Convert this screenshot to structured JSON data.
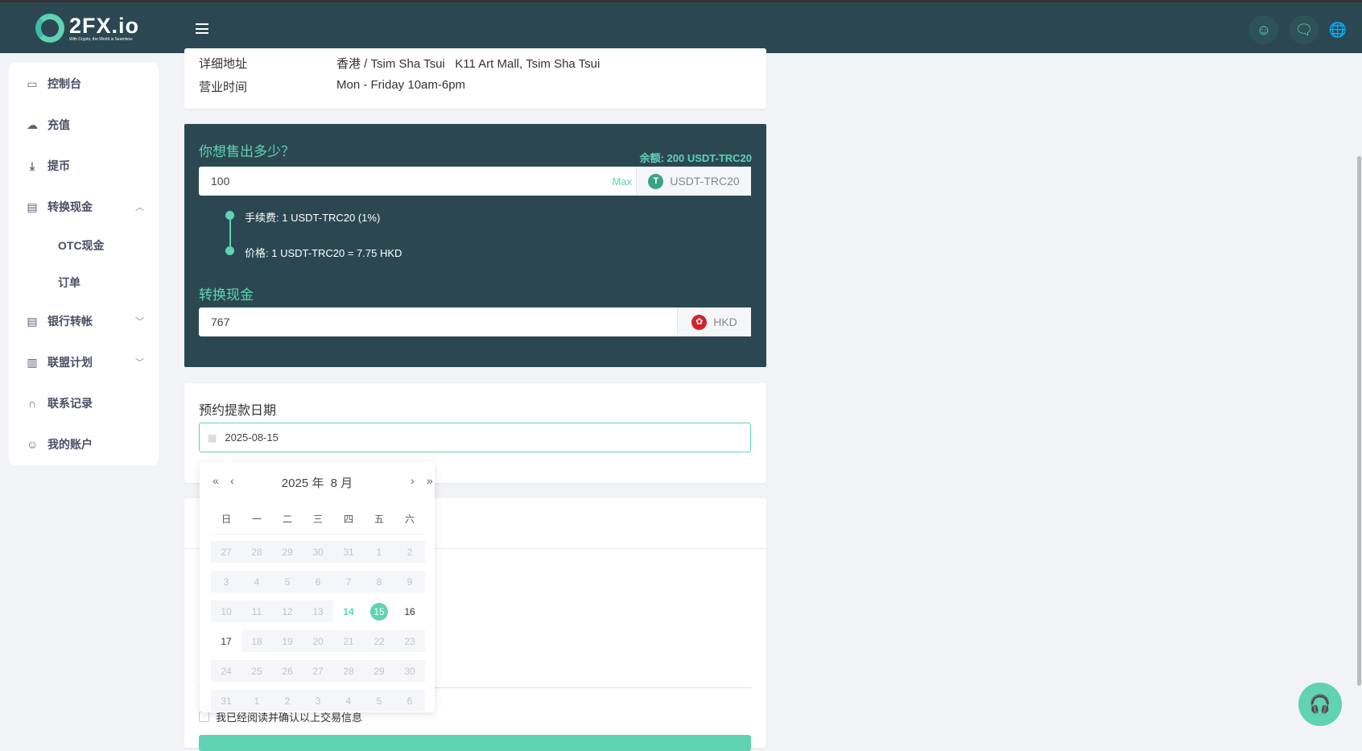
{
  "header": {
    "brand": "2FX.io",
    "tagline": "With Crypto, the World is Seamless"
  },
  "sidebar": {
    "items": [
      {
        "label": "控制台",
        "icon": "monitor-icon"
      },
      {
        "label": "充值",
        "icon": "cloud-upload-icon"
      },
      {
        "label": "提币",
        "icon": "download-icon"
      },
      {
        "label": "转换现金",
        "icon": "document-icon"
      },
      {
        "label": "OTC现金"
      },
      {
        "label": "订单"
      },
      {
        "label": "银行转帐",
        "icon": "document-icon"
      },
      {
        "label": "联盟计划",
        "icon": "building-icon"
      },
      {
        "label": "联系记录",
        "icon": "headset-icon"
      },
      {
        "label": "我的账户",
        "icon": "user-icon"
      }
    ]
  },
  "store": {
    "address_label": "详细地址",
    "address": "香港 / Tsim Sha Tsui   K11 Art Mall, Tsim Sha Tsui",
    "hours_label": "营业时间",
    "hours": "Mon - Friday 10am-6pm"
  },
  "sell": {
    "title": "你想售出多少？",
    "balance": "余额: 200 USDT-TRC20",
    "amount": "100",
    "max": "Max",
    "currency": "USDT-TRC20",
    "fee": "手续费: 1 USDT-TRC20 (1%)",
    "price": "价格: 1 USDT-TRC20 = 7.75 HKD",
    "convert_title": "转换现金",
    "converted": "767",
    "fiat": "HKD"
  },
  "schedule": {
    "title": "预约提款日期",
    "date": "2025-08-15"
  },
  "calendar": {
    "title": "2025 年  8 月",
    "weekdays": [
      "日",
      "一",
      "二",
      "三",
      "四",
      "五",
      "六"
    ],
    "days": [
      [
        "27",
        "dis"
      ],
      [
        "28",
        "dis"
      ],
      [
        "29",
        "dis"
      ],
      [
        "30",
        "dis"
      ],
      [
        "31",
        "dis"
      ],
      [
        "1",
        "dis"
      ],
      [
        "2",
        "dis"
      ],
      [
        "3",
        "dis"
      ],
      [
        "4",
        "dis"
      ],
      [
        "5",
        "dis"
      ],
      [
        "6",
        "dis"
      ],
      [
        "7",
        "dis"
      ],
      [
        "8",
        "dis"
      ],
      [
        "9",
        "dis"
      ],
      [
        "10",
        "dis"
      ],
      [
        "11",
        "dis"
      ],
      [
        "12",
        "dis"
      ],
      [
        "13",
        "dis"
      ],
      [
        "14",
        "today"
      ],
      [
        "15",
        "sel"
      ],
      [
        "16",
        ""
      ],
      [
        "17",
        ""
      ],
      [
        "18",
        "dis"
      ],
      [
        "19",
        "dis"
      ],
      [
        "20",
        "dis"
      ],
      [
        "21",
        "dis"
      ],
      [
        "22",
        "dis"
      ],
      [
        "23",
        "dis"
      ],
      [
        "24",
        "dis"
      ],
      [
        "25",
        "dis"
      ],
      [
        "26",
        "dis"
      ],
      [
        "27",
        "dis"
      ],
      [
        "28",
        "dis"
      ],
      [
        "29",
        "dis"
      ],
      [
        "30",
        "dis"
      ],
      [
        "31",
        "dis"
      ],
      [
        "1",
        "dis"
      ],
      [
        "2",
        "dis"
      ],
      [
        "3",
        "dis"
      ],
      [
        "4",
        "dis"
      ],
      [
        "5",
        "dis"
      ],
      [
        "6",
        "dis"
      ]
    ]
  },
  "confirm": {
    "label": "我已经阅读并确认以上交易信息"
  },
  "colors": {
    "accent": "#5fd3b3",
    "dark": "#2b4852"
  }
}
